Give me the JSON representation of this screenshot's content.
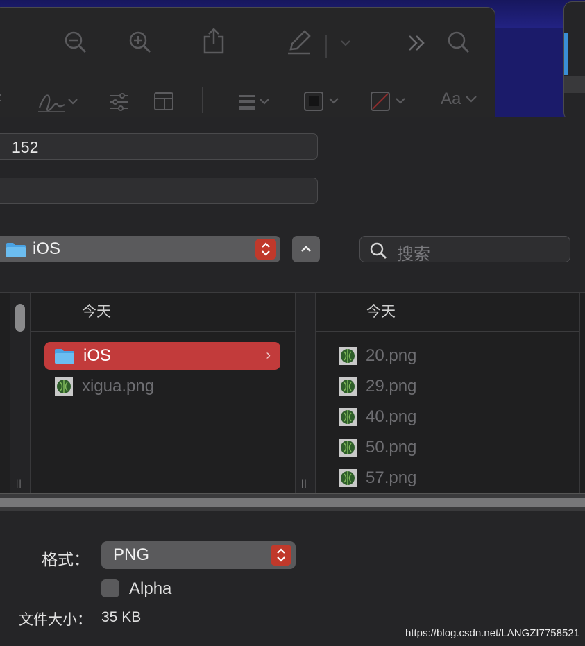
{
  "colors": {
    "accent": "#c23b3b",
    "stepper": "#c0392b",
    "folder": "#5ab0ea",
    "window": "#252527"
  },
  "toolbar": {
    "icons": [
      "zoom-out-icon",
      "zoom-in-icon",
      "share-icon",
      "markup-pen-icon",
      "chevron-down-icon",
      "more-icon",
      "search-icon",
      "signature-icon",
      "adjust-icon",
      "layout-icon",
      "line-style-icon",
      "border-color-icon",
      "fill-color-icon",
      "text-style-icon"
    ],
    "text_style_label": "Aa"
  },
  "save_as": {
    "value": "152"
  },
  "tags": {
    "value": ""
  },
  "location": {
    "selected": "iOS"
  },
  "search": {
    "placeholder": "搜索"
  },
  "browser": {
    "col1_header": "今天",
    "col1_items": [
      {
        "name": "iOS",
        "type": "folder",
        "selected": true
      },
      {
        "name": "xigua.png",
        "type": "image",
        "selected": false
      }
    ],
    "col2_header": "今天",
    "col2_items": [
      {
        "name": "20.png"
      },
      {
        "name": "29.png"
      },
      {
        "name": "40.png"
      },
      {
        "name": "50.png"
      },
      {
        "name": "57.png"
      }
    ]
  },
  "options": {
    "format_label": "格式：",
    "format_value": "PNG",
    "alpha_label": "Alpha",
    "size_label": "文件大小：",
    "size_value": "35 KB"
  },
  "watermark": "https://blog.csdn.net/LANGZI7758521"
}
